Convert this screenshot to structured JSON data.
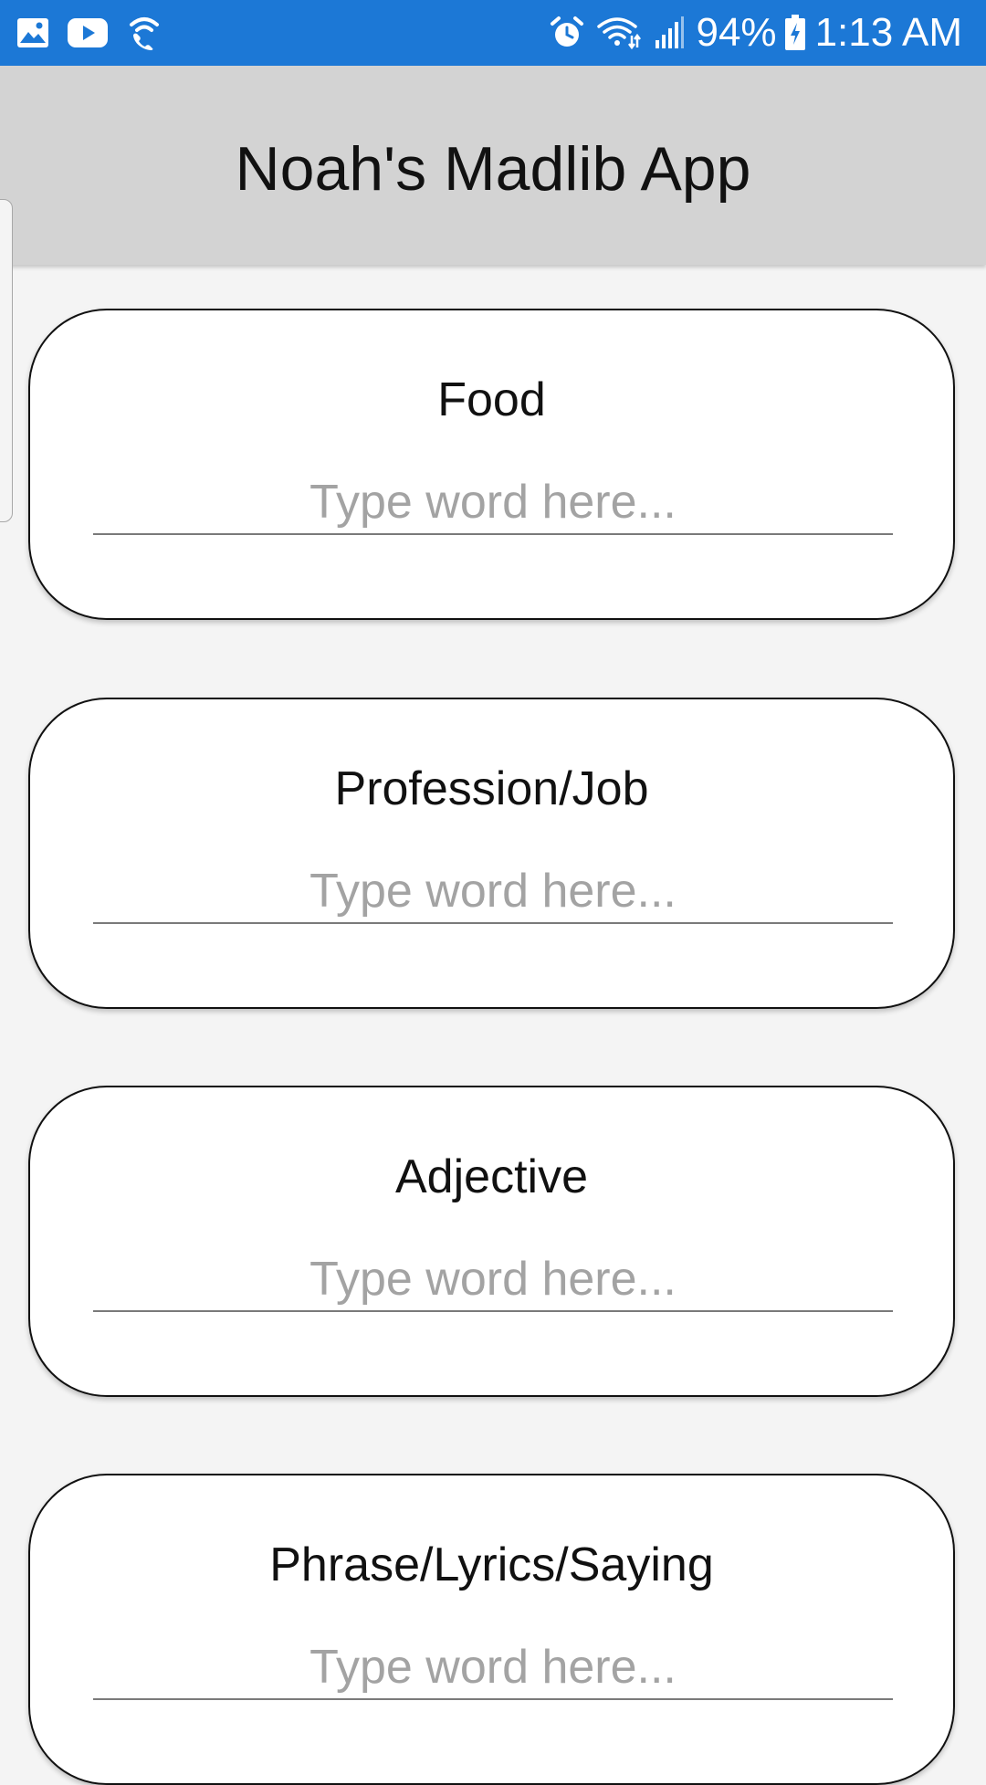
{
  "status_bar": {
    "battery_percent": "94%",
    "time": "1:13 AM",
    "icons_left": [
      "gallery-icon",
      "youtube-icon",
      "wifi-calling-icon"
    ],
    "icons_right": [
      "alarm-icon",
      "wifi-icon",
      "signal-icon",
      "battery-charging-icon"
    ]
  },
  "header": {
    "title": "Noah's Madlib App"
  },
  "cards": [
    {
      "label": "Food",
      "placeholder": "Type word here..."
    },
    {
      "label": "Profession/Job",
      "placeholder": "Type word here..."
    },
    {
      "label": "Adjective",
      "placeholder": "Type word here..."
    },
    {
      "label": "Phrase/Lyrics/Saying",
      "placeholder": "Type word here..."
    }
  ],
  "colors": {
    "status_bar": "#1c78d6",
    "header": "#d3d3d3",
    "background": "#f4f4f4",
    "card": "#ffffff",
    "placeholder": "#a3a3a3"
  }
}
